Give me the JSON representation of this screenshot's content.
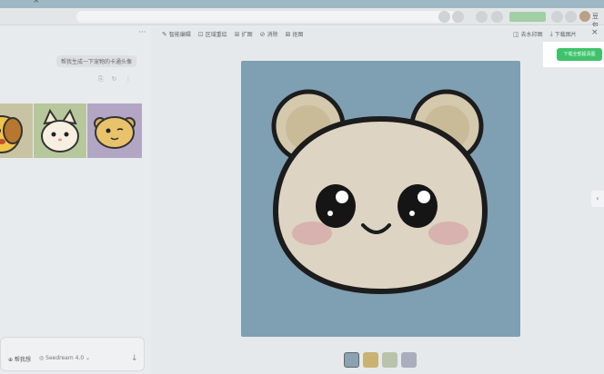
{
  "browser": {
    "tab_close": "×",
    "user_name": "豆包"
  },
  "left_panel": {
    "more": "···",
    "prompt": "帮我生成一下宠物的卡通头像",
    "actions": [
      "⎘",
      "↻",
      "⋮"
    ],
    "input": {
      "mode_label": "⊕ 帮我想",
      "model_label": "◎ Seedream 4.0 ⌄",
      "send": "↓"
    }
  },
  "toolbar": {
    "tools": [
      {
        "icon": "✎",
        "label": "智能编辑"
      },
      {
        "icon": "⊡",
        "label": "区域重绘"
      },
      {
        "icon": "⊞",
        "label": "扩图"
      },
      {
        "icon": "⊘",
        "label": "消除"
      },
      {
        "icon": "⊠",
        "label": "抠图"
      }
    ],
    "right_tools": [
      {
        "icon": "◫",
        "label": "去水印图"
      },
      {
        "icon": "⤓",
        "label": "下载图片"
      }
    ],
    "close": "×"
  },
  "download_all_label": "下载全部超清图",
  "side_expand": "‹",
  "colors": {
    "accent_green": "#3fc26b",
    "preview_bg": "#7f9fb2"
  }
}
